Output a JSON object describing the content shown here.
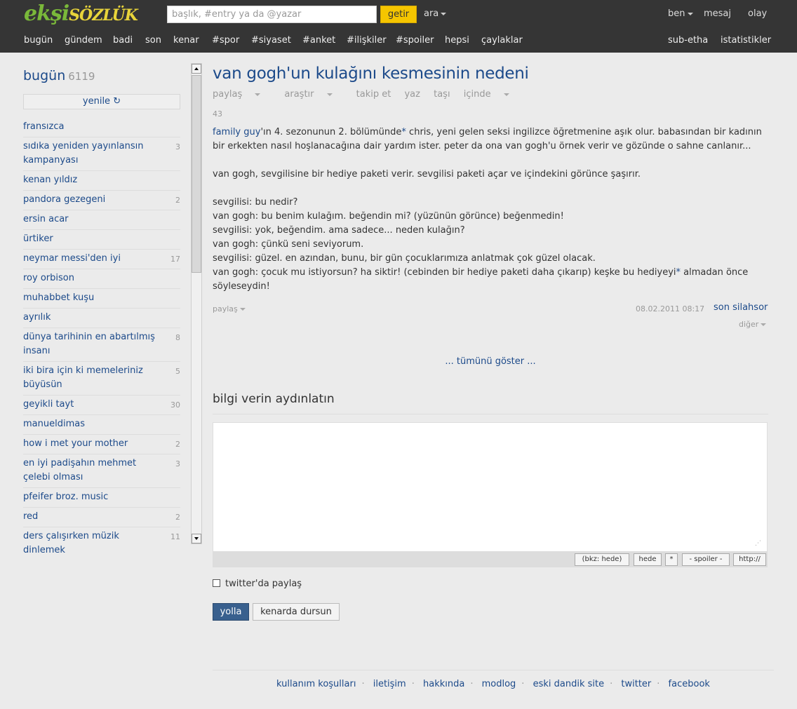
{
  "header": {
    "logo_part1": "ekşi",
    "logo_part2": "sözlük",
    "search_placeholder": "başlık, #entry ya da @yazar",
    "search_button": "getir",
    "ara": "ara",
    "ben": "ben",
    "mesaj": "mesaj",
    "olay": "olay"
  },
  "nav": {
    "items": [
      "bugün",
      "gündem",
      "badi",
      "son",
      "kenar",
      "#spor",
      "#siyaset",
      "#anket",
      "#ilişkiler",
      "#spoiler",
      "hepsi",
      "çaylaklar"
    ],
    "right": [
      "sub-etha",
      "istatistikler"
    ]
  },
  "sidebar": {
    "title": "bugün",
    "count": "6119",
    "refresh": "yenile ↻",
    "topics": [
      {
        "title": "fransızca",
        "count": ""
      },
      {
        "title": "sıdıka yeniden yayınlansın kampanyası",
        "count": "3"
      },
      {
        "title": "kenan yıldız",
        "count": ""
      },
      {
        "title": "pandora gezegeni",
        "count": "2"
      },
      {
        "title": "ersin acar",
        "count": ""
      },
      {
        "title": "ürtiker",
        "count": ""
      },
      {
        "title": "neymar messi'den iyi",
        "count": "17"
      },
      {
        "title": "roy orbison",
        "count": ""
      },
      {
        "title": "muhabbet kuşu",
        "count": ""
      },
      {
        "title": "ayrılık",
        "count": ""
      },
      {
        "title": "dünya tarihinin en abartılmış insanı",
        "count": "8"
      },
      {
        "title": "iki bira için ki memeleriniz büyüsün",
        "count": "5"
      },
      {
        "title": "geyikli tayt",
        "count": "30"
      },
      {
        "title": "manueldimas",
        "count": ""
      },
      {
        "title": "how i met your mother",
        "count": "2"
      },
      {
        "title": "en iyi padişahın mehmet çelebi olması",
        "count": "3"
      },
      {
        "title": "pfeifer broz. music",
        "count": ""
      },
      {
        "title": "red",
        "count": "2"
      },
      {
        "title": "ders çalışırken müzik dinlemek",
        "count": "11"
      }
    ]
  },
  "topic": {
    "title": "van gogh'un kulağını kesmesinin nedeni",
    "subnav": [
      "paylaş",
      "araştır",
      "takip et",
      "yaz",
      "taşı",
      "içinde"
    ],
    "page_count": "43"
  },
  "entry": {
    "intro_link": "family guy",
    "intro_rest": "'ın 4. sezonunun 2. bölümünde",
    "intro_star": "*",
    "intro_tail": " chris, yeni gelen seksi ingilizce öğretmenine aşık olur. babasından bir kadının bir erkekten nasıl hoşlanacağına dair yardım ister. peter da ona van gogh'u örnek verir ve gözünde o sahne canlanır...",
    "para2": "van gogh, sevgilisine bir hediye paketi verir. sevgilisi paketi açar ve içindekini görünce şaşırır.",
    "lines": [
      "sevgilisi: bu nedir?",
      "van gogh: bu benim kulağım. beğendin mi? (yüzünün görünce) beğenmedin!",
      "sevgilisi: yok, beğendim. ama sadece... neden kulağın?",
      "van gogh: çünkü seni seviyorum.",
      "sevgilisi: güzel. en azından, bunu, bir gün çocuklarımıza anlatmak çok güzel olacak."
    ],
    "last_line_start": "van gogh: çocuk mu istiyorsun? ha siktir! (cebinden bir hediye paketi daha çıkarıp) keşke bu hediyeyi",
    "last_star": "*",
    "last_line_end": " almadan önce söyleseydin!",
    "share": "paylaş",
    "date": "08.02.2011 08:17",
    "author": "son silahsor",
    "more": "diğer"
  },
  "show_all": "... tümünü göster ...",
  "form": {
    "title": "bilgi verin aydınlatın",
    "toolbar": [
      "(bkz: hede)",
      "hede",
      "*",
      "- spoiler -",
      "http://"
    ],
    "twitter_share": "twitter'da paylaş",
    "submit": "yolla",
    "draft": "kenarda dursun"
  },
  "footer": [
    "kullanım koşulları",
    "iletişim",
    "hakkında",
    "modlog",
    "eski dandik site",
    "twitter",
    "facebook"
  ],
  "colors": {
    "header_bg": "#353535",
    "link": "#1c4a8a",
    "getir_button": "#f5c500",
    "submit_button": "#39608e"
  }
}
